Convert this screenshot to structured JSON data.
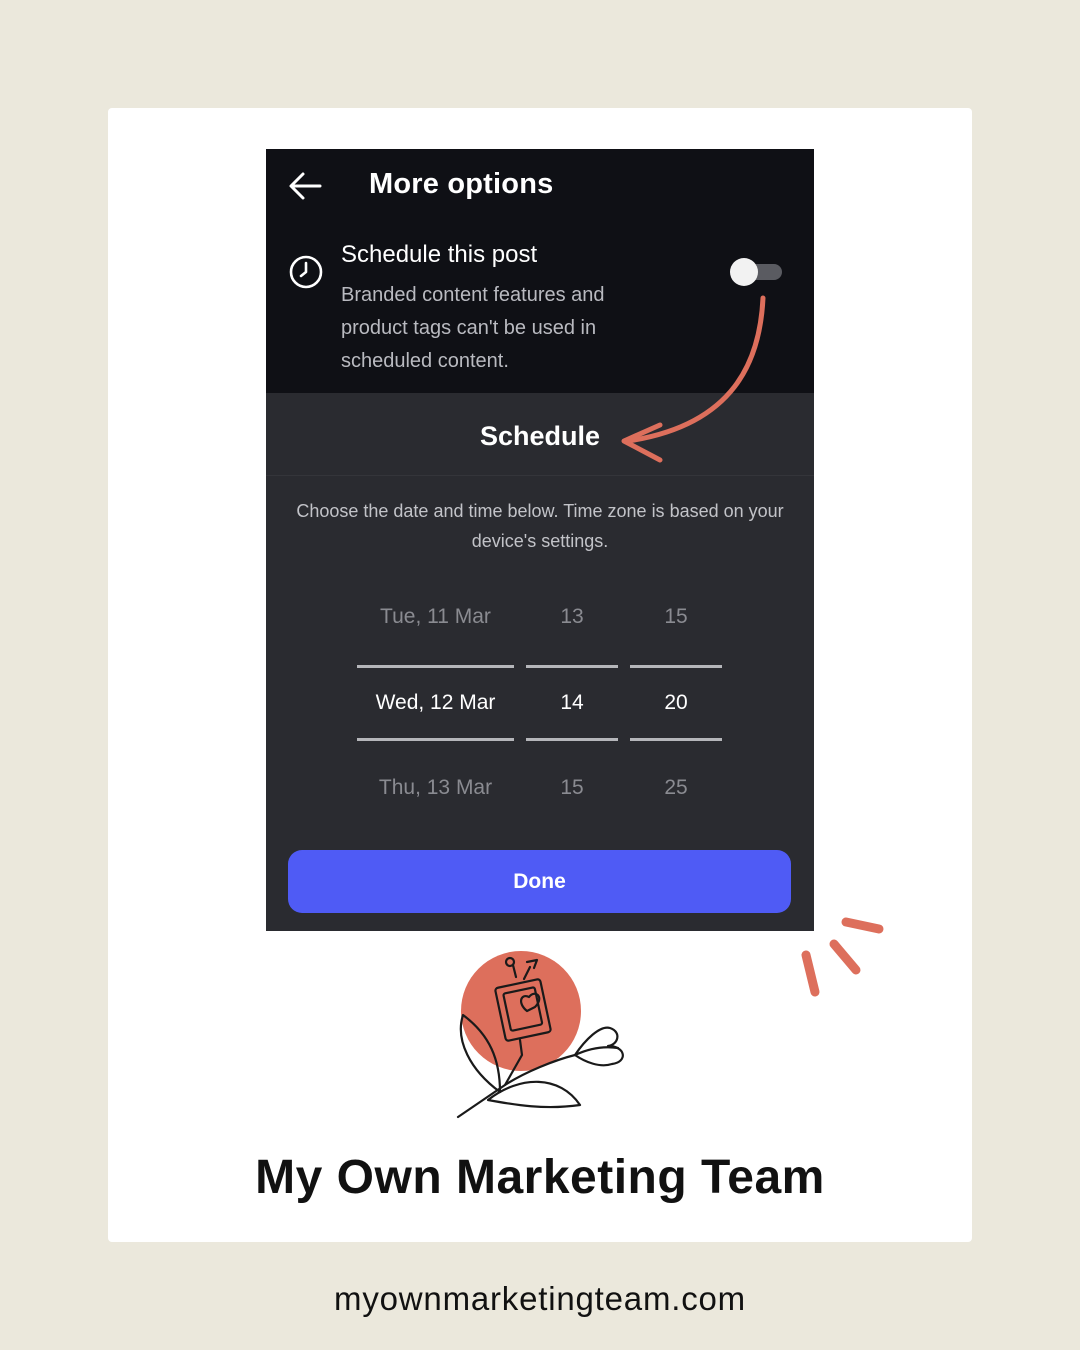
{
  "header": {
    "title": "More options",
    "back_icon": "arrow-left-icon"
  },
  "schedule_option": {
    "icon": "clock-icon",
    "title": "Schedule this post",
    "description": "Branded content features and product tags can't be used in scheduled content.",
    "toggle_on": false
  },
  "schedule_sheet": {
    "title": "Schedule",
    "description": "Choose the date and time below. Time zone is based on your device's settings.",
    "picker": {
      "date": {
        "prev": "Tue, 11 Mar",
        "selected": "Wed, 12 Mar",
        "next": "Thu, 13 Mar"
      },
      "hour": {
        "prev": "13",
        "selected": "14",
        "next": "15"
      },
      "minute": {
        "prev": "15",
        "selected": "20",
        "next": "25"
      }
    },
    "done_label": "Done"
  },
  "branding": {
    "name": "My Own Marketing Team",
    "website": "myownmarketingteam.com",
    "logo_icon": "phone-flower-logo-icon",
    "accent_color": "#dd6f5c",
    "button_color": "#4f5bf5"
  }
}
